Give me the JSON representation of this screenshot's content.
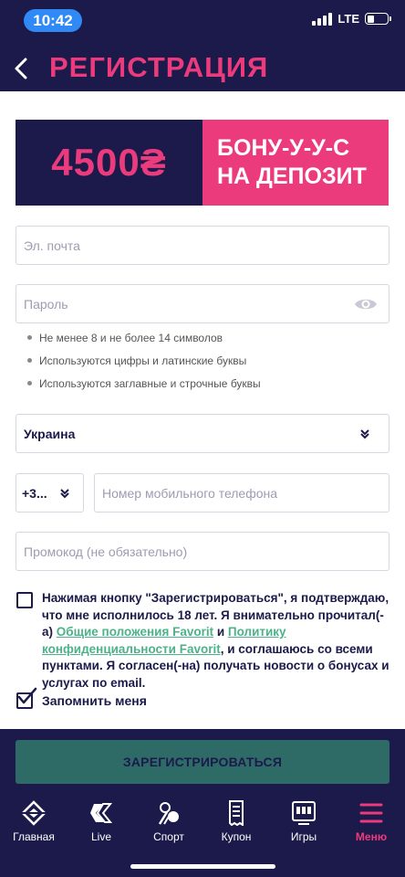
{
  "status_bar": {
    "time": "10:42",
    "network": "LTE",
    "battery_level": 0.35
  },
  "header": {
    "title": "РЕГИСТРАЦИЯ"
  },
  "banner": {
    "amount": "4500₴",
    "line1": "БОНУ-У-У-С",
    "line2": "НА ДЕПОЗИТ"
  },
  "form": {
    "email_placeholder": "Эл. почта",
    "password_placeholder": "Пароль",
    "password_hints": [
      "Не менее 8 и не более 14 символов",
      "Используются цифры и латинские буквы",
      "Используются заглавные и строчные буквы"
    ],
    "country": "Украина",
    "phone_code": "+3...",
    "phone_placeholder": "Номер мобильного телефона",
    "promo_placeholder": "Промокод (не обязательно)"
  },
  "consent": {
    "text_1": "Нажимая кнопку \"Зарегистрироваться\", я подтверждаю, что мне исполнилось 18 лет. Я внимательно прочитал(-а) ",
    "link_1": "Общие положения Favorit",
    "text_2": " и ",
    "link_2": "Политику конфиденциальности Favorit",
    "text_3": ", и соглашаюсь со всеми пунктами. Я согласен(-на) получать новости о бонусах и услугах по email.",
    "checked": false
  },
  "remember": {
    "label": "Запомнить меня",
    "checked": true
  },
  "submit_label": "ЗАРЕГИСТРИРОВАТЬСЯ",
  "tabbar": {
    "items": [
      {
        "label": "Главная",
        "icon": "favorit-logo-icon"
      },
      {
        "label": "Live",
        "icon": "live-icon"
      },
      {
        "label": "Спорт",
        "icon": "sport-icon"
      },
      {
        "label": "Купон",
        "icon": "coupon-icon"
      },
      {
        "label": "Игры",
        "icon": "games-icon"
      },
      {
        "label": "Меню",
        "icon": "menu-icon",
        "active": true
      }
    ]
  },
  "colors": {
    "navy": "#1b1a4a",
    "pink": "#ec3b7c",
    "green_link": "#4db28a",
    "button": "#2e6b67"
  }
}
